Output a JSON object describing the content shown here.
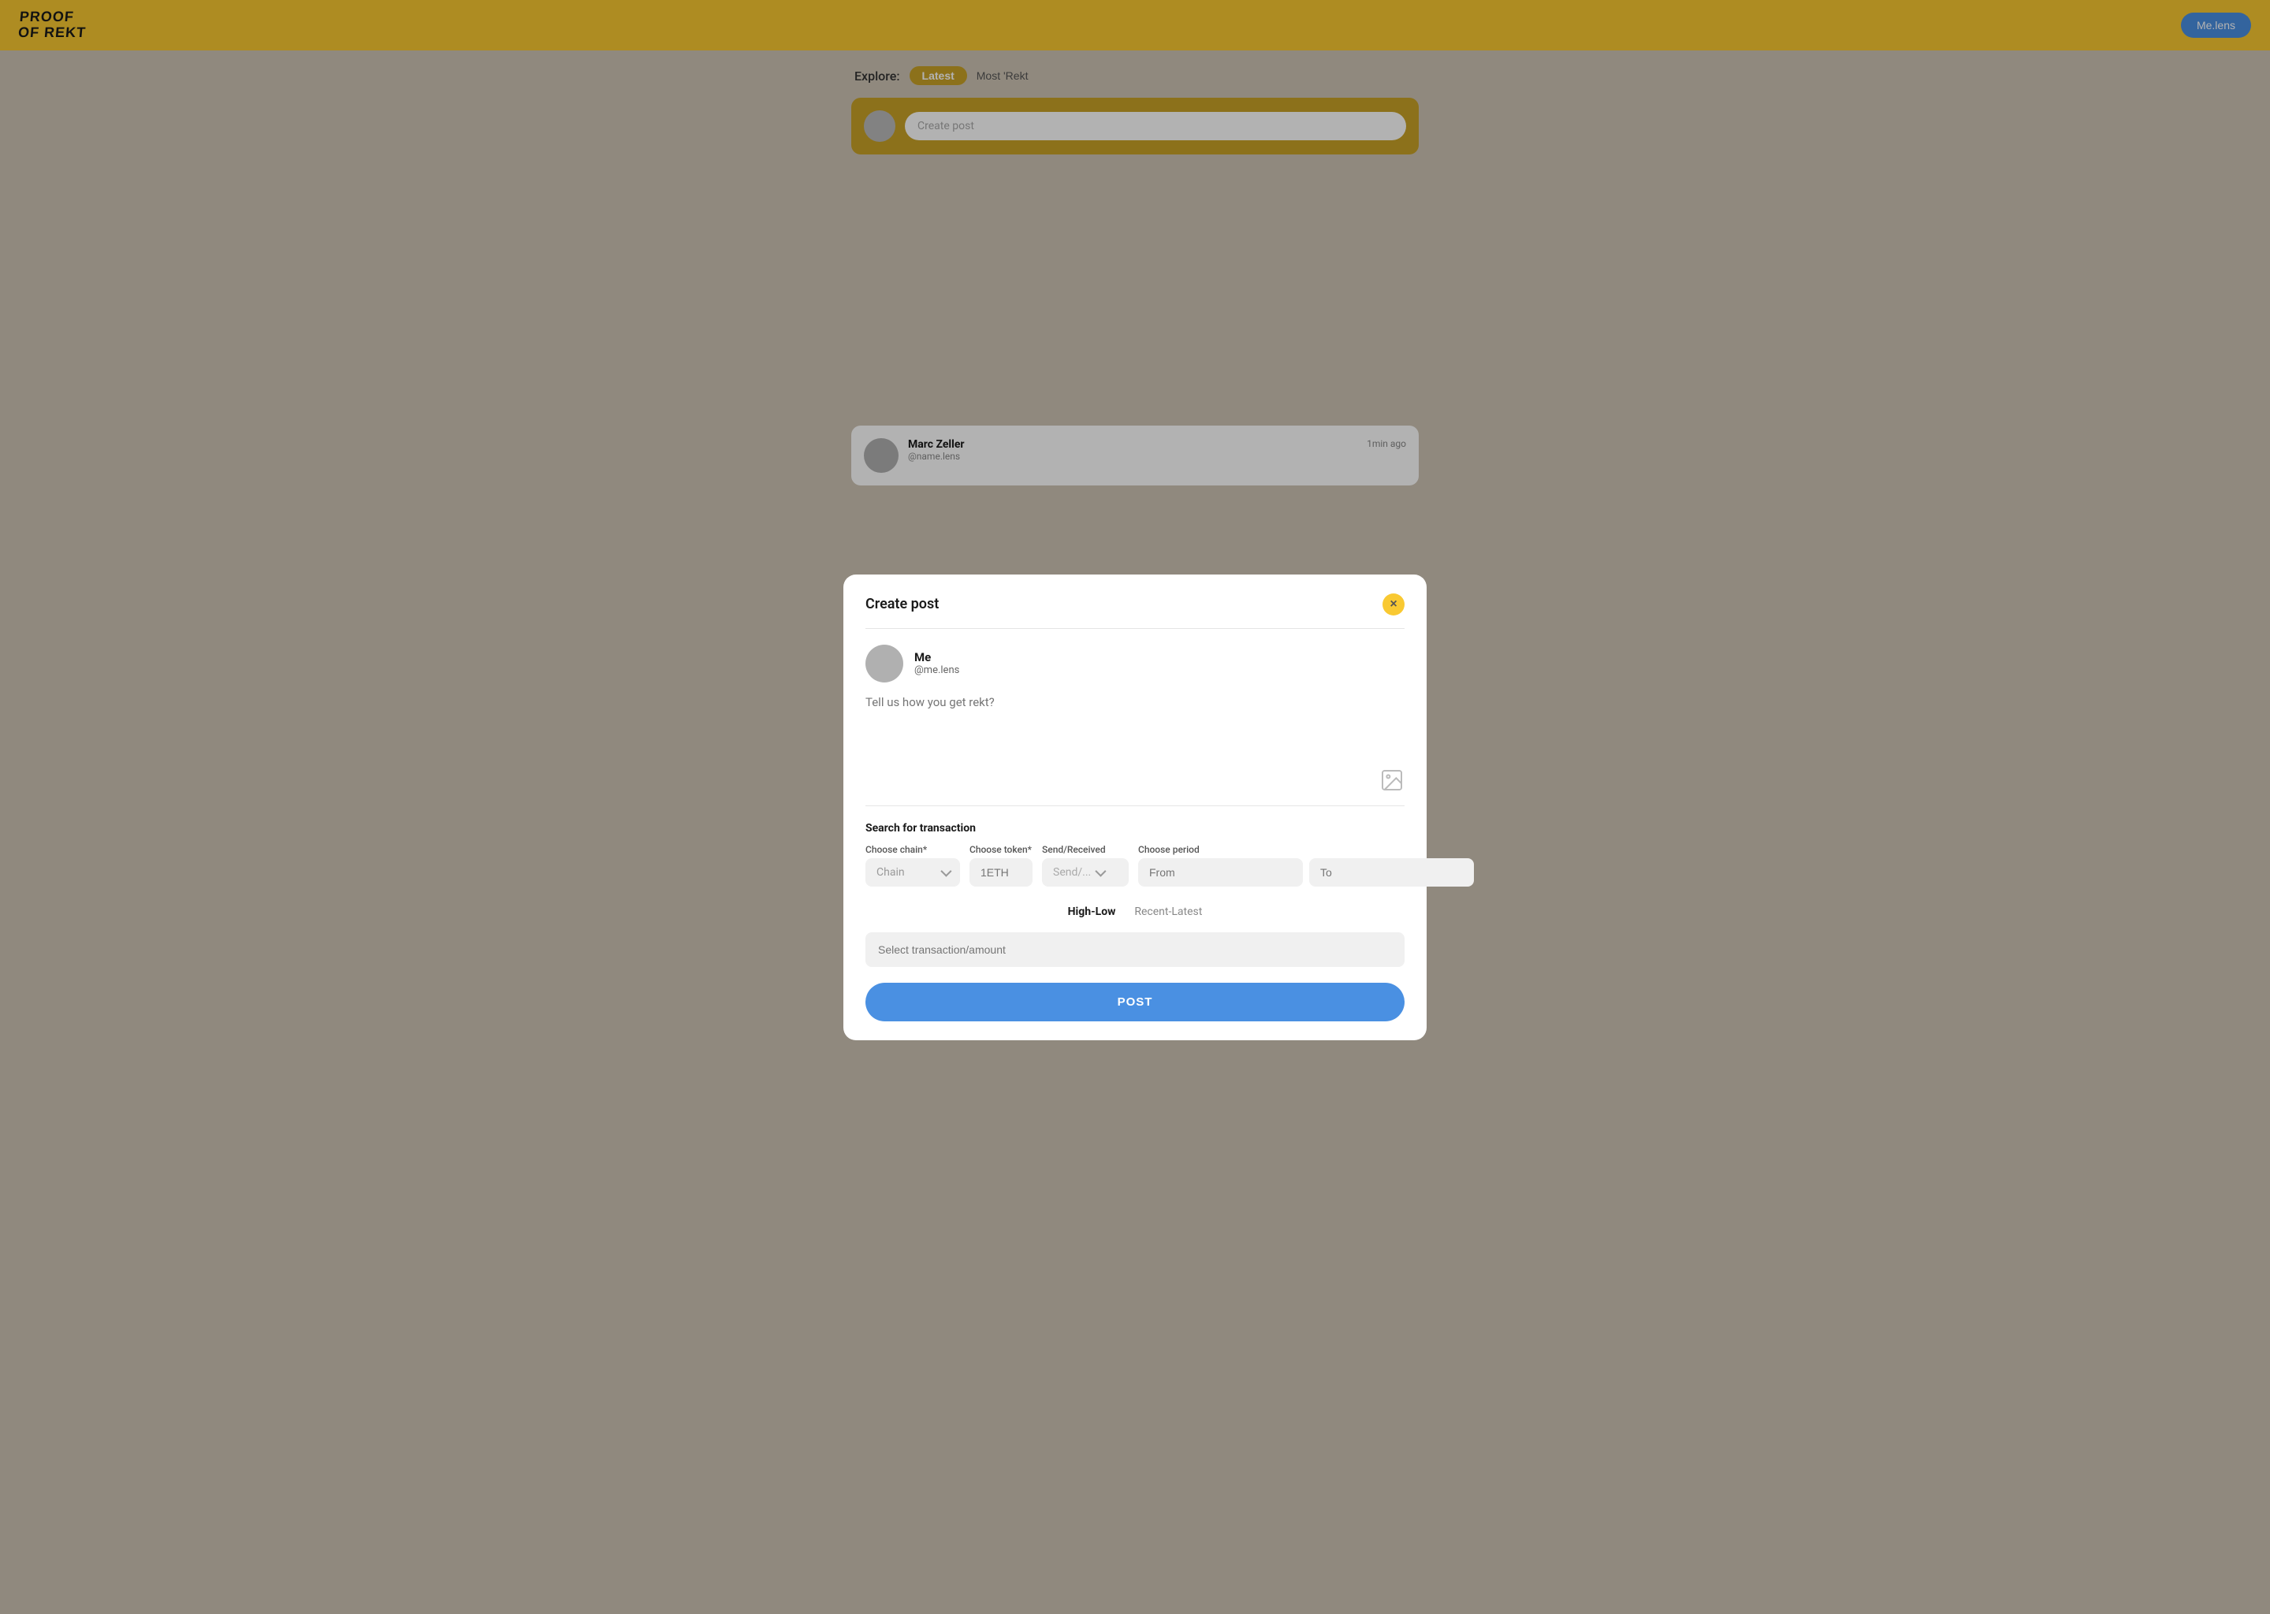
{
  "header": {
    "logo_line1": "PROOF",
    "logo_line2": "OF REKT",
    "me_lens_label": "Me.lens"
  },
  "explore": {
    "label": "Explore:",
    "tab_latest": "Latest",
    "tab_most_rekt": "Most 'Rekt"
  },
  "create_post_bar": {
    "placeholder": "Create post"
  },
  "modal": {
    "title": "Create post",
    "close_label": "×",
    "user": {
      "name": "Me",
      "handle": "@me.lens"
    },
    "post_placeholder": "Tell us how you get rekt?",
    "search_section": {
      "title": "Search for transaction",
      "chain_label": "Choose chain*",
      "chain_placeholder": "Chain",
      "token_label": "Choose token*",
      "token_placeholder": "1ETH",
      "send_received_label": "Send/Received",
      "send_received_placeholder": "Send/...",
      "period_label": "Choose period",
      "from_placeholder": "From",
      "to_placeholder": "To"
    },
    "sort_tabs": [
      {
        "label": "High-Low",
        "active": true
      },
      {
        "label": "Recent-Latest",
        "active": false
      }
    ],
    "transaction_placeholder": "Select transaction/amount",
    "post_button_label": "POST"
  },
  "bottom_post": {
    "name": "Marc Zeller",
    "handle": "@name.lens",
    "time": "1min ago"
  }
}
